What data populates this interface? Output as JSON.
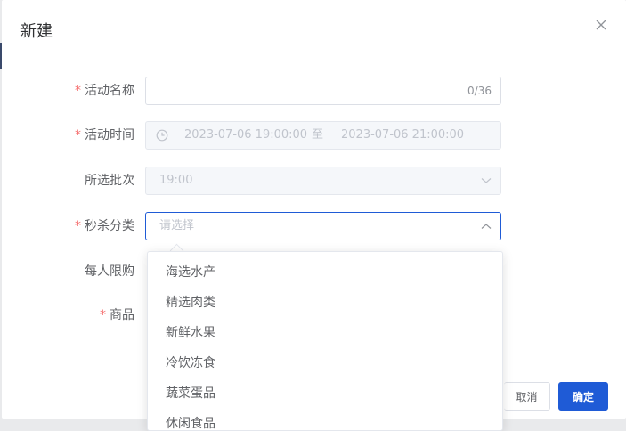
{
  "dialog": {
    "title": "新建"
  },
  "form": {
    "required_mark": "*",
    "activity_name": {
      "label": "活动名称",
      "value": "",
      "counter": "0/36"
    },
    "activity_time": {
      "label": "活动时间",
      "start": "2023-07-06 19:00:00",
      "separator": "至",
      "end": "2023-07-06 21:00:00"
    },
    "batch": {
      "label": "所选批次",
      "value": "19:00"
    },
    "category": {
      "label": "秒杀分类",
      "placeholder": "请选择"
    },
    "per_person_limit": {
      "label": "每人限购"
    },
    "product": {
      "label": "商品"
    }
  },
  "category_options": [
    "海选水产",
    "精选肉类",
    "新鲜水果",
    "冷饮冻食",
    "蔬菜蛋品",
    "休闲食品"
  ],
  "footer": {
    "cancel_label": "取消",
    "ok_label": "确定"
  },
  "colors": {
    "primary": "#1f5bd6",
    "required": "#f56c6c"
  }
}
